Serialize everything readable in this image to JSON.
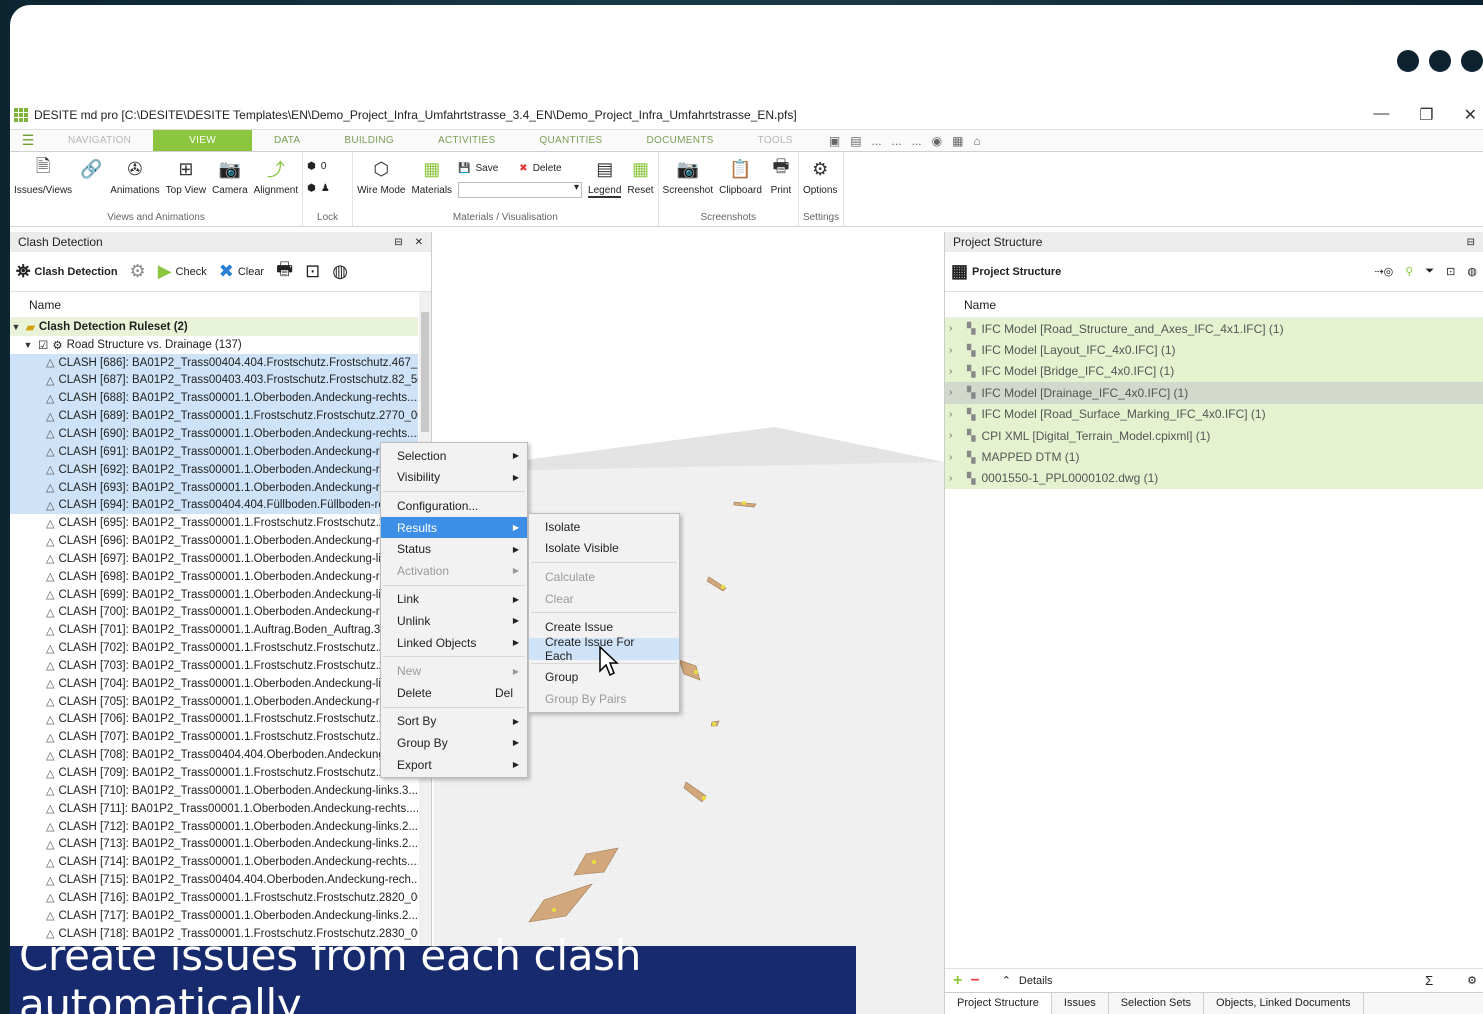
{
  "window": {
    "title": "DESITE md pro [C:\\DESITE\\DESITE Templates\\EN\\Demo_Project_Infra_Umfahrtstrasse_3.4_EN\\Demo_Project_Infra_Umfahrtstrasse_EN.pfs]",
    "minimize": "—",
    "restore": "❐",
    "close": "✕"
  },
  "ribbon_tabs": [
    "NAVIGATION",
    "VIEW",
    "DATA",
    "BUILDING",
    "ACTIVITIES",
    "QUANTITIES",
    "DOCUMENTS",
    "TOOLS"
  ],
  "active_tab": "VIEW",
  "ribbon": {
    "issues_views": "Issues/Views",
    "animations": "Animations",
    "top_view": "Top View",
    "camera": "Camera",
    "alignment": "Alignment",
    "group_views": "Views and Animations",
    "lock_count": "0",
    "group_lock": "Lock",
    "wire_mode": "Wire Mode",
    "materials": "Materials",
    "save": "Save",
    "delete": "Delete",
    "legend": "Legend",
    "reset": "Reset",
    "group_materials": "Materials / Visualisation",
    "screenshot": "Screenshot",
    "clipboard": "Clipboard",
    "group_screenshots": "Screenshots",
    "print": "Print",
    "options": "Options",
    "group_settings": "Settings",
    "qa_dots": "..."
  },
  "clash_panel": {
    "title": "Clash Detection",
    "tb_title": "Clash Detection",
    "check": "Check",
    "clear": "Clear",
    "col_name": "Name",
    "ruleset": "Clash Detection Ruleset (2)",
    "rule": "Road Structure vs. Drainage (137)",
    "rows": [
      "CLASH [686]: BA01P2_Trass00404.404.Frostschutz.Frostschutz.467_5...",
      "CLASH [687]: BA01P2_Trass00403.403.Frostschutz.Frostschutz.82_50...",
      "CLASH [688]: BA01P2_Trass00001.1.Oberboden.Andeckung-rechts....",
      "CLASH [689]: BA01P2_Trass00001.1.Frostschutz.Frostschutz.2770_00...",
      "CLASH [690]: BA01P2_Trass00001.1.Oberboden.Andeckung-rechts....",
      "CLASH [691]: BA01P2_Trass00001.1.Oberboden.Andeckung-re",
      "CLASH [692]: BA01P2_Trass00001.1.Oberboden.Andeckung-re",
      "CLASH [693]: BA01P2_Trass00001.1.Oberboden.Andeckung-re",
      "CLASH [694]: BA01P2_Trass00404.404.Füllboden.Füllboden-re",
      "CLASH [695]: BA01P2_Trass00001.1.Frostschutz.Frostschutz.27",
      "CLASH [696]: BA01P2_Trass00001.1.Oberboden.Andeckung-re",
      "CLASH [697]: BA01P2_Trass00001.1.Oberboden.Andeckung-lir",
      "CLASH [698]: BA01P2_Trass00001.1.Oberboden.Andeckung-re",
      "CLASH [699]: BA01P2_Trass00001.1.Oberboden.Andeckung-lir",
      "CLASH [700]: BA01P2_Trass00001.1.Oberboden.Andeckung-re",
      "CLASH [701]: BA01P2_Trass00001.1.Auftrag.Boden_Auftrag.32",
      "CLASH [702]: BA01P2_Trass00001.1.Frostschutz.Frostschutz.27",
      "CLASH [703]: BA01P2_Trass00001.1.Frostschutz.Frostschutz.28",
      "CLASH [704]: BA01P2_Trass00001.1.Oberboden.Andeckung-lir",
      "CLASH [705]: BA01P2_Trass00001.1.Oberboden.Andeckung-re",
      "CLASH [706]: BA01P2_Trass00001.1.Frostschutz.Frostschutz.29",
      "CLASH [707]: BA01P2_Trass00001.1.Frostschutz.Frostschutz.29",
      "CLASH [708]: BA01P2_Trass00404.404.Oberboden.Andeckung",
      "CLASH [709]: BA01P2_Trass00001.1.Frostschutz.Frostschutz.24",
      "CLASH [710]: BA01P2_Trass00001.1.Oberboden.Andeckung-links.3...",
      "CLASH [711]: BA01P2_Trass00001.1.Oberboden.Andeckung-rechts....",
      "CLASH [712]: BA01P2_Trass00001.1.Oberboden.Andeckung-links.2...",
      "CLASH [713]: BA01P2_Trass00001.1.Oberboden.Andeckung-links.2...",
      "CLASH [714]: BA01P2_Trass00001.1.Oberboden.Andeckung-rechts....",
      "CLASH [715]: BA01P2_Trass00404.404.Oberboden.Andeckung-rech...",
      "CLASH [716]: BA01P2_Trass00001.1.Frostschutz.Frostschutz.2820_00...",
      "CLASH [717]: BA01P2_Trass00001.1.Oberboden.Andeckung-links.2...",
      "CLASH [718]: BA01P2_Trass00001.1.Frostschutz.Frostschutz.2830_00..."
    ]
  },
  "context_menu": {
    "items": [
      {
        "label": "Selection",
        "arrow": true
      },
      {
        "label": "Visibility",
        "arrow": true
      },
      {
        "sep": true
      },
      {
        "label": "Configuration..."
      },
      {
        "label": "Results",
        "arrow": true,
        "active": true
      },
      {
        "label": "Status",
        "arrow": true
      },
      {
        "label": "Activation",
        "arrow": true,
        "disabled": true
      },
      {
        "sep": true
      },
      {
        "label": "Link",
        "arrow": true
      },
      {
        "label": "Unlink",
        "arrow": true
      },
      {
        "label": "Linked Objects",
        "arrow": true
      },
      {
        "sep": true
      },
      {
        "label": "New",
        "arrow": true,
        "disabled": true
      },
      {
        "label": "Delete",
        "shortcut": "Del"
      },
      {
        "sep": true
      },
      {
        "label": "Sort By",
        "arrow": true
      },
      {
        "label": "Group By",
        "arrow": true
      },
      {
        "label": "Export",
        "arrow": true
      }
    ]
  },
  "submenu": {
    "items": [
      {
        "label": "Isolate"
      },
      {
        "label": "Isolate Visible"
      },
      {
        "sep": true
      },
      {
        "label": "Calculate",
        "disabled": true
      },
      {
        "label": "Clear",
        "disabled": true
      },
      {
        "sep": true
      },
      {
        "label": "Create Issue"
      },
      {
        "label": "Create Issue For Each",
        "hover": true
      },
      {
        "sep": true
      },
      {
        "label": "Group"
      },
      {
        "label": "Group By Pairs",
        "disabled": true
      }
    ]
  },
  "project_panel": {
    "title": "Project Structure",
    "tb_title": "Project Structure",
    "col_name": "Name",
    "rows": [
      "IFC Model [Road_Structure_and_Axes_IFC_4x1.IFC] (1)",
      "IFC Model [Layout_IFC_4x0.IFC] (1)",
      "IFC Model [Bridge_IFC_4x0.IFC] (1)",
      "IFC Model [Drainage_IFC_4x0.IFC] (1)",
      "IFC Model [Road_Surface_Marking_IFC_4x0.IFC] (1)",
      "CPI XML [Digital_Terrain_Model.cpixml] (1)",
      "MAPPED DTM (1)",
      "0001550-1_PPL0000102.dwg (1)"
    ],
    "details": "Details",
    "sigma": "Σ",
    "tabs": [
      "Project Structure",
      "Issues",
      "Selection Sets",
      "Objects, Linked Documents"
    ]
  },
  "caption": "Create issues from each clash automatically",
  "colors": {
    "accent": "#8cc63f",
    "selection": "#cfe3f8",
    "menu_active": "#3d8ee6",
    "caption_bg": "#182a6e"
  }
}
